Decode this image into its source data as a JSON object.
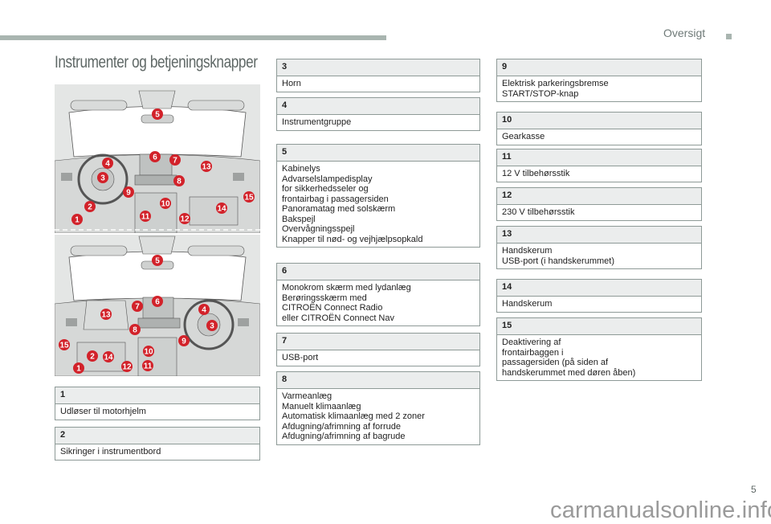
{
  "header": {
    "section_label": "Oversigt",
    "page_title": "Instrumenter og betjeningsknapper"
  },
  "colors": {
    "accent_bar": "#a9b5b0",
    "marker_red": "#d2222a",
    "box_border": "#8e9a97",
    "box_header_bg": "#ebeded"
  },
  "illustrations": [
    {
      "name": "left-hand-drive dashboard",
      "markers": [
        "5",
        "6",
        "7",
        "4",
        "13",
        "3",
        "8",
        "9",
        "10",
        "15",
        "2",
        "14",
        "1",
        "11",
        "12"
      ]
    },
    {
      "name": "right-hand-drive dashboard",
      "markers": [
        "5",
        "6",
        "7",
        "4",
        "13",
        "3",
        "8",
        "9",
        "15",
        "10",
        "2",
        "14",
        "11",
        "1",
        "12"
      ]
    }
  ],
  "items": [
    {
      "num": "1",
      "lines": [
        "Udløser til motorhjelm"
      ]
    },
    {
      "num": "2",
      "lines": [
        "Sikringer i instrumentbord"
      ]
    },
    {
      "num": "3",
      "lines": [
        "Horn"
      ]
    },
    {
      "num": "4",
      "lines": [
        "Instrumentgruppe"
      ]
    },
    {
      "num": "5",
      "lines": [
        "Kabinelys",
        "Advarselslampedisplay",
        "for sikkerhedsseler og",
        "frontairbag i passagersiden",
        "Panoramatag med solskærm",
        "Bakspejl",
        "Overvågningsspejl",
        "Knapper til nød- og vejhjælpsopkald"
      ]
    },
    {
      "num": "6",
      "lines": [
        "Monokrom skærm med lydanlæg",
        "Berøringsskærm med",
        "CITROËN Connect Radio",
        "eller CITROËN Connect Nav"
      ]
    },
    {
      "num": "7",
      "lines": [
        "USB-port"
      ]
    },
    {
      "num": "8",
      "lines": [
        "Varmeanlæg",
        "Manuelt klimaanlæg",
        "Automatisk klimaanlæg med 2 zoner",
        "Afdugning/afrimning af forrude",
        "Afdugning/afrimning af bagrude"
      ]
    },
    {
      "num": "9",
      "lines": [
        "Elektrisk parkeringsbremse",
        "START/STOP-knap"
      ]
    },
    {
      "num": "10",
      "lines": [
        "Gearkasse"
      ]
    },
    {
      "num": "11",
      "lines": [
        "12 V tilbehørsstik"
      ]
    },
    {
      "num": "12",
      "lines": [
        "230 V tilbehørsstik"
      ]
    },
    {
      "num": "13",
      "lines": [
        "Handskerum",
        "USB-port (i handskerummet)"
      ]
    },
    {
      "num": "14",
      "lines": [
        "Handskerum"
      ]
    },
    {
      "num": "15",
      "lines": [
        "Deaktivering af",
        "frontairbaggen i",
        "passagersiden (på siden af",
        "handskerummet med døren åben)"
      ]
    }
  ],
  "footer": {
    "page_number": "5",
    "watermark": "carmanualsonline.info"
  }
}
